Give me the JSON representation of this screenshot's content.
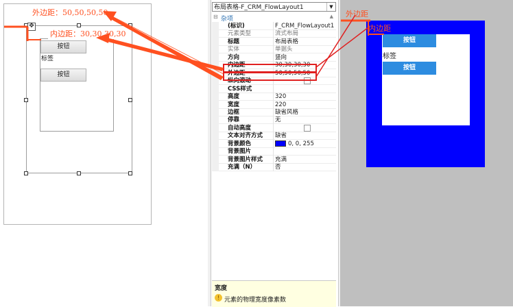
{
  "designer": {
    "outer_annotation": "外边距：50,50,50,50",
    "inner_annotation": "内边距：30,30,30,30",
    "button1": "按钮",
    "label": "标签",
    "button2": "按钮"
  },
  "properties": {
    "selected_object": "布局表格-F_CRM_FlowLayout1",
    "category": "杂项",
    "rows": [
      {
        "name": "(标识)",
        "value": "F_CRM_FlowLayout1",
        "style": "bold"
      },
      {
        "name": "元素类型",
        "value": "流式布局",
        "style": "dim"
      },
      {
        "name": "标题",
        "value": "布局表格",
        "style": "bold"
      },
      {
        "name": "实体",
        "value": "单据头",
        "style": "dim"
      },
      {
        "name": "方向",
        "value": "竖向",
        "style": "bold"
      },
      {
        "name": "内边距",
        "value": "30,30,30,30",
        "style": "bold"
      },
      {
        "name": "外边距",
        "value": "50,50,50,50",
        "style": "bold"
      },
      {
        "name": "纵向滚动",
        "value": "",
        "style": "bold"
      },
      {
        "name": "CSS样式",
        "value": "",
        "style": "bold"
      },
      {
        "name": "高度",
        "value": "320",
        "style": "bold"
      },
      {
        "name": "宽度",
        "value": "220",
        "style": "bold"
      },
      {
        "name": "边框",
        "value": "缺省风格",
        "style": "bold"
      },
      {
        "name": "停靠",
        "value": "无",
        "style": "bold"
      },
      {
        "name": "自动高度",
        "value": "",
        "style": "bold"
      },
      {
        "name": "文本对齐方式",
        "value": "缺省",
        "style": "bold"
      },
      {
        "name": "背景颜色",
        "value": "0, 0, 255",
        "style": "bold"
      },
      {
        "name": "背景图片",
        "value": "",
        "style": "bold"
      },
      {
        "name": "背景图片样式",
        "value": "充满",
        "style": "bold"
      },
      {
        "name": "充满（N）",
        "value": "否",
        "style": "bold"
      }
    ],
    "description_title": "宽度",
    "description_text": "元素的物理宽度像素数"
  },
  "preview": {
    "outer_annotation": "外边距",
    "inner_annotation": "内边距",
    "button1": "按钮",
    "label": "标签",
    "button2": "按钮"
  },
  "colors": {
    "annotation": "#ff5020",
    "highlight_box": "#e02020",
    "preview_blue": "#0000ff",
    "preview_button": "#2d8ce0"
  }
}
